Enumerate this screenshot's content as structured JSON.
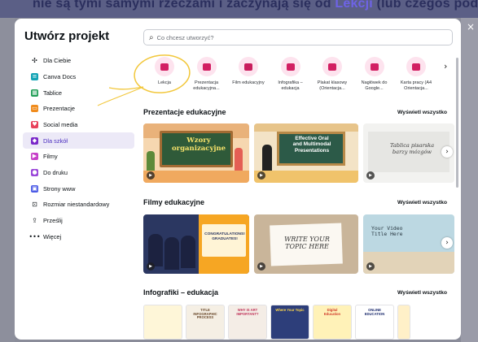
{
  "backdrop": {
    "header_text": "nie są tymi samymi rzeczami i zaczynają się od",
    "header_accent": "Lekcji",
    "header_tail": "(lub czegoś podobnego)."
  },
  "modal": {
    "title": "Utwórz projekt",
    "close_glyph": "×",
    "search": {
      "glyph": "⌕",
      "placeholder": "Co chcesz utworzyć?"
    }
  },
  "sidebar": {
    "items": [
      {
        "label": "Dla Ciebie",
        "icon": "sparkle-icon",
        "glyph": "✣",
        "color": "#0d1216"
      },
      {
        "label": "Canva Docs",
        "icon": "docs-icon",
        "glyph": "≡",
        "color": "#13a3b5"
      },
      {
        "label": "Tablice",
        "icon": "whiteboard-icon",
        "glyph": "▦",
        "color": "#1f9d55"
      },
      {
        "label": "Prezentacje",
        "icon": "presentation-icon",
        "glyph": "▭",
        "color": "#f08c1e"
      },
      {
        "label": "Social media",
        "icon": "heart-icon",
        "glyph": "♥",
        "color": "#e8415b"
      },
      {
        "label": "Dla szkół",
        "icon": "graduation-cap-icon",
        "glyph": "◆",
        "color": "#7a28c9"
      },
      {
        "label": "Filmy",
        "icon": "video-icon",
        "glyph": "▶",
        "color": "#c63fc8"
      },
      {
        "label": "Do druku",
        "icon": "print-icon",
        "glyph": "●",
        "color": "#9a47d9"
      },
      {
        "label": "Strony www",
        "icon": "website-icon",
        "glyph": "▣",
        "color": "#4d5ce6"
      },
      {
        "label": "Rozmiar niestandardowy",
        "icon": "custom-size-icon",
        "glyph": "⊡",
        "color": "#0d1216"
      },
      {
        "label": "Prześlij",
        "icon": "upload-icon",
        "glyph": "⇪",
        "color": "#0d1216"
      },
      {
        "label": "Więcej",
        "icon": "more-icon",
        "glyph": "•••",
        "color": "#0d1216"
      }
    ],
    "active_index": 5
  },
  "types": {
    "next_glyph": "›",
    "items": [
      {
        "label": "Lekcja",
        "bg": "#fde3ee",
        "fg": "#d21f62"
      },
      {
        "label": "Prezentacja\nedukacyjna...",
        "bg": "#fde3ee",
        "fg": "#d21f62"
      },
      {
        "label": "Film edukacyjny",
        "bg": "#fde3ee",
        "fg": "#c91d5d"
      },
      {
        "label": "Infografika –\nedukacja",
        "bg": "#fde3ee",
        "fg": "#d21f62"
      },
      {
        "label": "Plakat klasowy\n(Orientacja...",
        "bg": "#fde3ee",
        "fg": "#d21f62"
      },
      {
        "label": "Nagłówek do\nGoogle...",
        "bg": "#fde3ee",
        "fg": "#d21f62"
      },
      {
        "label": "Karta pracy (A4\nOrientacja...",
        "bg": "#fde3ee",
        "fg": "#d21f62"
      }
    ]
  },
  "sections": [
    {
      "title": "Prezentacje edukacyjne",
      "see_all": "Wyświetl wszystko",
      "cards": [
        {
          "text": "Wzory\norganizacyjne",
          "sub": ""
        },
        {
          "text": "Effective Oral\nand Multimodal\nPresentations",
          "sub": ""
        },
        {
          "text": "Tablica pisarska\nbarzy mózgów",
          "sub": ""
        }
      ]
    },
    {
      "title": "Filmy edukacyjne",
      "see_all": "Wyświetl wszystko",
      "cards": [
        {
          "text": "CONGRATULATIONS!\nGRADUATES!",
          "sub": ""
        },
        {
          "text": "WRITE YOUR\nTOPIC HERE",
          "sub": ""
        },
        {
          "text": "Your Video\nTitle Here",
          "sub": ""
        }
      ]
    },
    {
      "title": "Infografiki – edukacja",
      "see_all": "Wyświetl wszystko",
      "minis": [
        {
          "text": ""
        },
        {
          "text": "TITLE INFOGRAPHIC\nPROCESS"
        },
        {
          "text": "WHY IS ART\nIMPORTANT?"
        },
        {
          "text": "Where Your Topic"
        },
        {
          "text": "Digital\nEducation"
        },
        {
          "text": "ONLINE\nEDUCATION"
        },
        {
          "text": ""
        }
      ]
    }
  ],
  "card_play_glyph": "▶",
  "row_next_glyph": "›"
}
